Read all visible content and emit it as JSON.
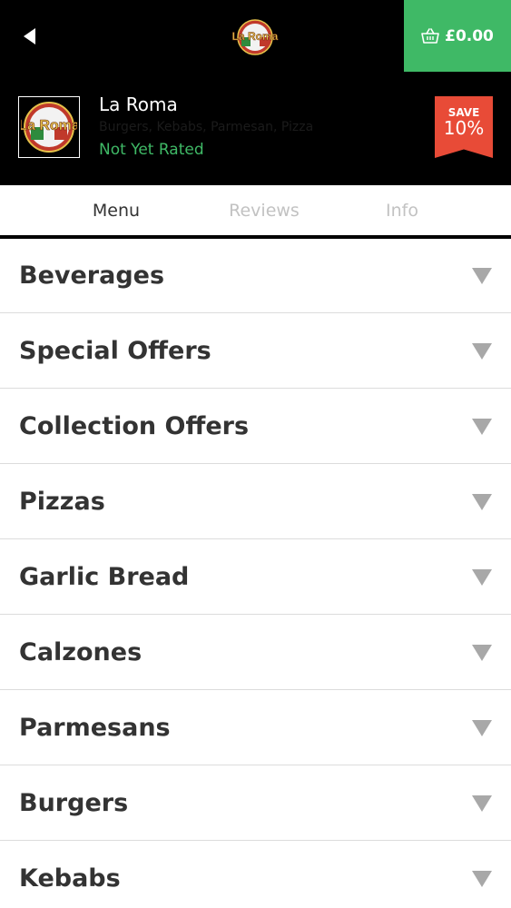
{
  "topbar": {
    "back_icon": "back-arrow-icon",
    "logo_text": "La Roma",
    "basket_icon": "basket-icon",
    "basket_total": "£0.00",
    "accent_color": "#3fb966"
  },
  "restaurant": {
    "logo_text": "La Roma",
    "name": "La Roma",
    "cuisines": "Burgers, Kebabs, Parmesan, Pizza",
    "rating": "Not Yet Rated",
    "save_label": "SAVE",
    "save_value": "10%",
    "ribbon_color": "#e84b37"
  },
  "tabs": [
    {
      "label": "Menu",
      "active": true
    },
    {
      "label": "Reviews",
      "active": false
    },
    {
      "label": "Info",
      "active": false
    }
  ],
  "menu": {
    "caret_icon": "chevron-down-icon",
    "categories": [
      {
        "label": "Beverages"
      },
      {
        "label": "Special Offers"
      },
      {
        "label": "Collection Offers"
      },
      {
        "label": "Pizzas"
      },
      {
        "label": "Garlic Bread"
      },
      {
        "label": "Calzones"
      },
      {
        "label": "Parmesans"
      },
      {
        "label": "Burgers"
      },
      {
        "label": "Kebabs"
      }
    ]
  }
}
